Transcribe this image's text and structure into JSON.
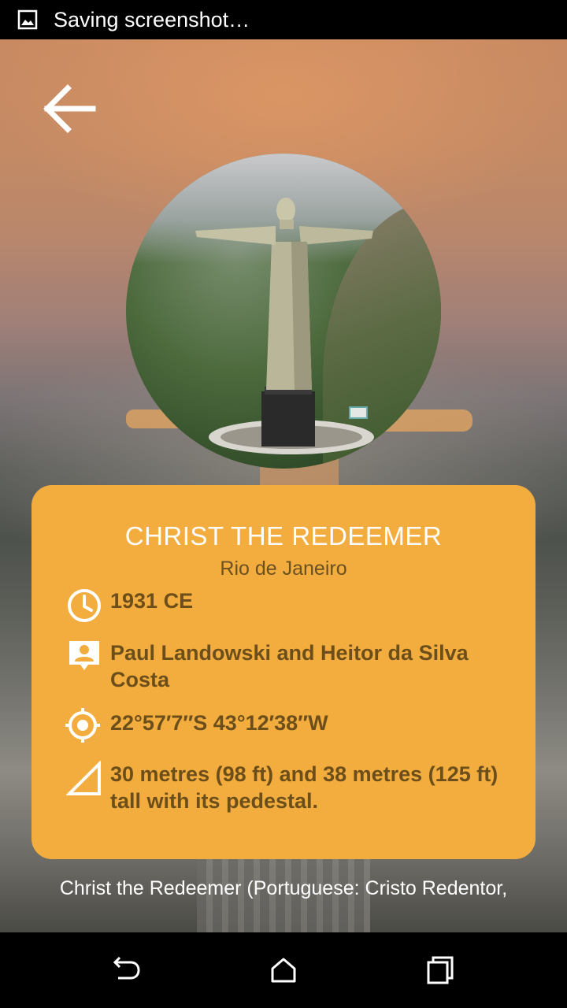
{
  "status_bar": {
    "notification_icon": "image-icon",
    "text": "Saving screenshot…"
  },
  "header": {
    "back_icon": "arrow-left-icon"
  },
  "hero": {
    "image": "christ-the-redeemer-photo"
  },
  "card": {
    "title": "CHRIST THE REDEEMER",
    "subtitle": "Rio de Janeiro",
    "rows": [
      {
        "icon": "clock-icon",
        "text": "1931 CE"
      },
      {
        "icon": "person-badge-icon",
        "text": "Paul Landowski and Heitor da Silva Costa"
      },
      {
        "icon": "location-target-icon",
        "text": "22°57′7″S 43°12′38″W"
      },
      {
        "icon": "triangle-ruler-icon",
        "text": "30 metres (98 ft) and 38 metres (125 ft) tall with its pedestal."
      }
    ],
    "color": "#f3ad3f"
  },
  "description": "Christ the Redeemer (Portuguese: Cristo Redentor,",
  "nav_bar": {
    "back": "nav-back-icon",
    "home": "nav-home-icon",
    "recents": "nav-recents-icon"
  }
}
